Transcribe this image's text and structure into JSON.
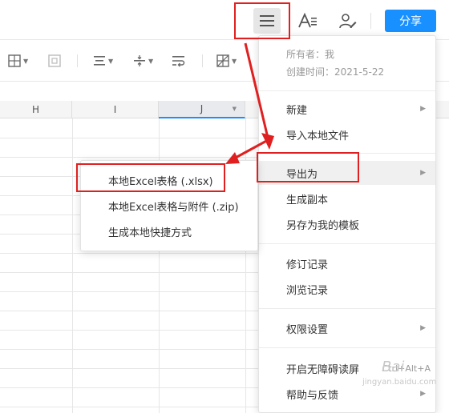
{
  "header": {
    "share_label": "分享"
  },
  "columns": [
    "H",
    "I",
    "J"
  ],
  "menu": {
    "owner": "所有者：我",
    "created": "创建时间：2021-5-22",
    "items": [
      {
        "label": "新建",
        "has_arrow": true
      },
      {
        "label": "导入本地文件",
        "has_arrow": false
      },
      {
        "label": "导出为",
        "has_arrow": true
      },
      {
        "label": "生成副本",
        "has_arrow": false
      },
      {
        "label": "另存为我的模板",
        "has_arrow": false
      },
      {
        "label": "修订记录",
        "has_arrow": false
      },
      {
        "label": "浏览记录",
        "has_arrow": false
      },
      {
        "label": "权限设置",
        "has_arrow": true
      },
      {
        "label": "开启无障碍读屏",
        "shortcut": "Ctrl+Alt+A"
      },
      {
        "label": "帮助与反馈",
        "has_arrow": true
      }
    ]
  },
  "submenu": {
    "items": [
      {
        "label": "本地Excel表格 (.xlsx)"
      },
      {
        "label": "本地Excel表格与附件 (.zip)"
      },
      {
        "label": "生成本地快捷方式"
      }
    ]
  },
  "watermark": {
    "brand": "Bai",
    "site": "jingyan.baidu.com"
  },
  "colors": {
    "accent": "#1890ff",
    "annotation": "#e02020"
  }
}
